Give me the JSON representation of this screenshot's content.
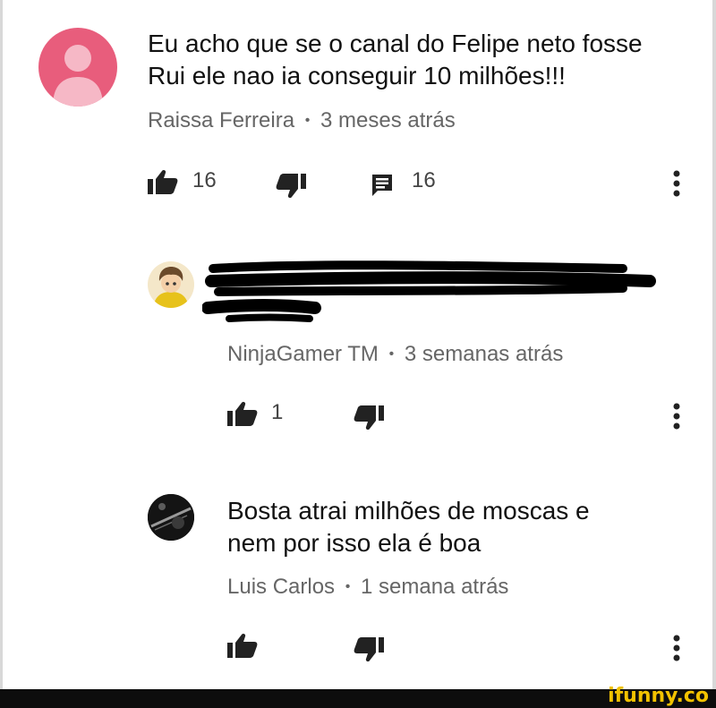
{
  "comments": [
    {
      "text_line1": "Eu acho que se o canal do Felipe neto fosse",
      "text_line2": "Rui ele nao ia conseguir 10 milhões!!!",
      "author": "Raissa Ferreira",
      "time": "3 meses atrás",
      "likes": "16",
      "replies": "16",
      "avatar_color": "#e85d7c"
    },
    {
      "author": "NinjaGamer TM",
      "time": "3 semanas atrás",
      "likes": "1",
      "text_redacted": true
    },
    {
      "text_line1": "Bosta atrai milhões de moscas e",
      "text_line2": "nem por isso ela é boa",
      "author": "Luis Carlos",
      "time": "1 semana atrás",
      "likes": ""
    }
  ],
  "separator": "•",
  "watermark": "ifunny.co",
  "icons": {
    "like": "thumbs-up-icon",
    "dislike": "thumbs-down-icon",
    "reply": "comment-icon",
    "more": "more-vert-icon"
  }
}
